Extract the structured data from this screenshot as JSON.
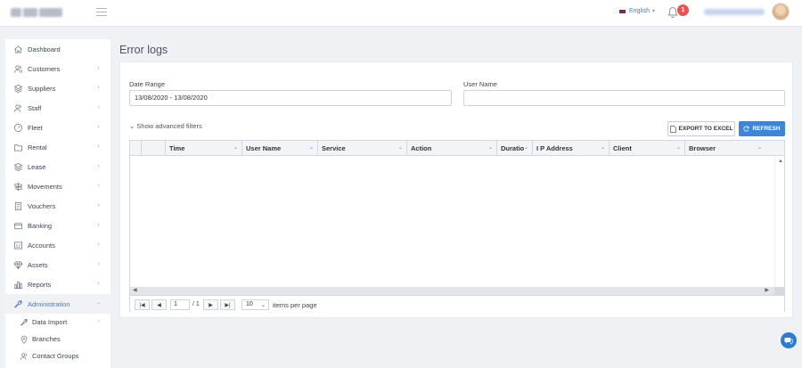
{
  "header": {
    "language": "English",
    "notification_count": "1"
  },
  "sidebar": {
    "items": [
      {
        "label": "Dashboard"
      },
      {
        "label": "Customers"
      },
      {
        "label": "Suppliers"
      },
      {
        "label": "Staff"
      },
      {
        "label": "Fleet"
      },
      {
        "label": "Rental"
      },
      {
        "label": "Lease"
      },
      {
        "label": "Movements"
      },
      {
        "label": "Vouchers"
      },
      {
        "label": "Banking"
      },
      {
        "label": "Accounts"
      },
      {
        "label": "Assets"
      },
      {
        "label": "Reports"
      },
      {
        "label": "Administration"
      }
    ],
    "sub_items": [
      {
        "label": "Data Import"
      },
      {
        "label": "Branches"
      },
      {
        "label": "Contact Groups"
      }
    ]
  },
  "page": {
    "title": "Error logs"
  },
  "filters": {
    "date_range_label": "Date Range",
    "date_range_value": "13/08/2020 - 13/08/2020",
    "user_name_label": "User Name",
    "user_name_value": "",
    "advanced_label": "Show advanced filters"
  },
  "actions": {
    "export_label": "EXPORT TO EXCEL",
    "refresh_label": "REFRESH"
  },
  "grid": {
    "columns": [
      "Time",
      "User Name",
      "Service",
      "Action",
      "Duratio",
      "I P Address",
      "Client",
      "Browser"
    ],
    "rows": []
  },
  "pager": {
    "page": "1",
    "of_text": "/ 1",
    "page_size": "10",
    "items_per_page": "items per page"
  },
  "colors": {
    "accent": "#3b86d6",
    "sidebar_active": "#4a78c8",
    "badge": "#e25656"
  }
}
